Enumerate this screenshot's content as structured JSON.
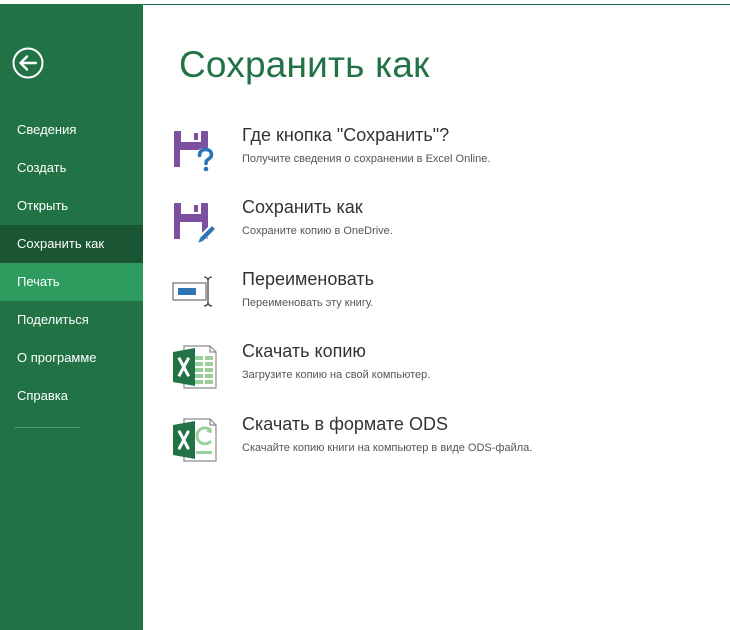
{
  "sidebar": {
    "back_icon": "back-arrow-circle-icon",
    "items": [
      {
        "label": "Сведения",
        "state": "normal"
      },
      {
        "label": "Создать",
        "state": "normal"
      },
      {
        "label": "Открыть",
        "state": "normal"
      },
      {
        "label": "Сохранить как",
        "state": "selected"
      },
      {
        "label": "Печать",
        "state": "hover"
      },
      {
        "label": "Поделиться",
        "state": "normal"
      },
      {
        "label": "О программе",
        "state": "normal"
      },
      {
        "label": "Справка",
        "state": "normal"
      }
    ]
  },
  "main": {
    "title": "Сохранить как",
    "options": [
      {
        "icon": "save-question-icon",
        "title": "Где кнопка \"Сохранить\"?",
        "description": "Получите сведения о сохранении в Excel Online."
      },
      {
        "icon": "save-as-icon",
        "title": "Сохранить как",
        "description": "Сохраните копию в OneDrive."
      },
      {
        "icon": "rename-icon",
        "title": "Переименовать",
        "description": "Переименовать эту книгу."
      },
      {
        "icon": "excel-download-icon",
        "title": "Скачать копию",
        "description": "Загрузите копию на свой компьютер."
      },
      {
        "icon": "ods-download-icon",
        "title": "Скачать в формате ODS",
        "description": "Скачайте копию книги на компьютер в виде ODS-файла."
      }
    ]
  },
  "colors": {
    "brand_green": "#217346",
    "sidebar_selected": "#1a5633",
    "sidebar_hover": "#2f9c5f",
    "icon_purple": "#7d4fa0",
    "icon_blue": "#2e75b6"
  }
}
